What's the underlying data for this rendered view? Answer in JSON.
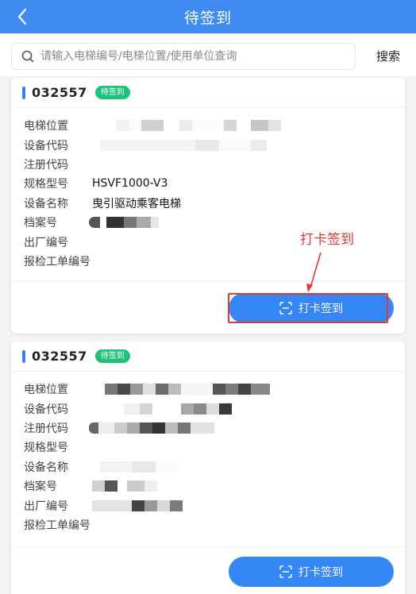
{
  "header": {
    "title": "待签到",
    "back_icon": "chevron-left-icon"
  },
  "search": {
    "placeholder": "请输入电梯编号/电梯位置/使用单位查询",
    "value": "",
    "button_label": "搜索"
  },
  "cards": [
    {
      "code": "032557",
      "status": "待签到",
      "fields": [
        {
          "label": "电梯位置",
          "value": ""
        },
        {
          "label": "设备代码",
          "value": ""
        },
        {
          "label": "注册代码",
          "value": ""
        },
        {
          "label": "规格型号",
          "value": "HSVF1000-V3"
        },
        {
          "label": "设备名称",
          "value": "曳引驱动乘客电梯"
        },
        {
          "label": "档案号",
          "value": ""
        },
        {
          "label": "出厂编号",
          "value": ""
        },
        {
          "label": "报检工单编号",
          "value": ""
        }
      ],
      "action_label": "打卡签到"
    },
    {
      "code": "032557",
      "status": "待签到",
      "fields": [
        {
          "label": "电梯位置",
          "value": ""
        },
        {
          "label": "设备代码",
          "value": ""
        },
        {
          "label": "注册代码",
          "value": ""
        },
        {
          "label": "规格型号",
          "value": ""
        },
        {
          "label": "设备名称",
          "value": ""
        },
        {
          "label": "档案号",
          "value": ""
        },
        {
          "label": "出厂编号",
          "value": ""
        },
        {
          "label": "报检工单编号",
          "value": ""
        }
      ],
      "action_label": "打卡签到"
    }
  ],
  "annotation": {
    "text": "打卡签到",
    "color": "#e53935"
  },
  "colors": {
    "header": "#3f8bf2",
    "button": "#3587f5",
    "badge": "#1ec37b"
  }
}
